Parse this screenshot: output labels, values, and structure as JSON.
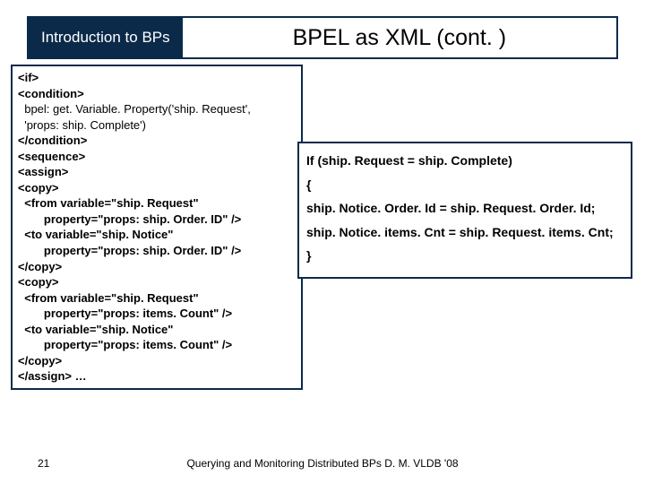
{
  "header": {
    "tab": "Introduction to BPs",
    "title": "BPEL as XML (cont. )"
  },
  "code": {
    "l1": "<if>",
    "l2": "<condition>",
    "l3": "  bpel: get. Variable. Property('ship. Request',",
    "l4": "  'props: ship. Complete')",
    "l5": "</condition>",
    "l6": "<sequence>",
    "l7": "<assign>",
    "l8": "<copy>",
    "l9": "  <from variable=\"ship. Request\"",
    "l10": "        property=\"props: ship. Order. ID\" />",
    "l11": "  <to variable=\"ship. Notice\"",
    "l12": "        property=\"props: ship. Order. ID\" />",
    "l13": "</copy>",
    "l14": "<copy>",
    "l15": "  <from variable=\"ship. Request\"",
    "l16": "        property=\"props: items. Count\" />",
    "l17": "  <to variable=\"ship. Notice\"",
    "l18": "        property=\"props: items. Count\" />",
    "l19": "</copy>",
    "l20": "</assign> …"
  },
  "pseudo": {
    "p1": "If (ship. Request = ship. Complete)",
    "p2": "{",
    "p3": "ship. Notice. Order. Id = ship. Request. Order. Id;",
    "p4": "ship. Notice. items. Cnt = ship. Request. items. Cnt;",
    "p5": "}"
  },
  "footer": {
    "page": "21",
    "credit": "Querying and Monitoring Distributed BPs D. M. VLDB '08"
  }
}
